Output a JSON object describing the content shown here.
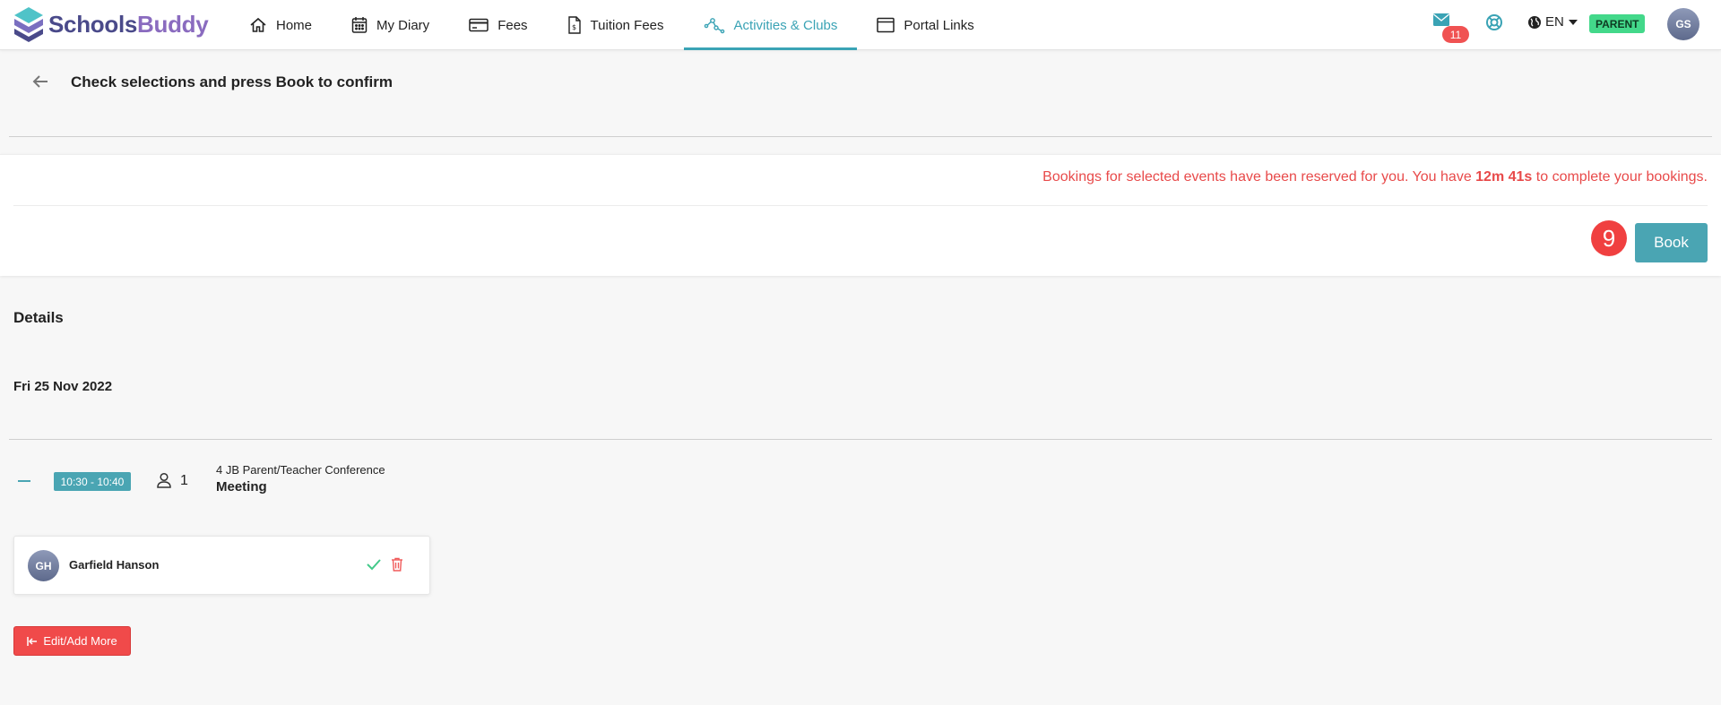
{
  "app": {
    "logo_schools": "Schools",
    "logo_buddy": "Buddy"
  },
  "nav": {
    "items": [
      {
        "label": "Home",
        "icon": "home-icon"
      },
      {
        "label": "My Diary",
        "icon": "calendar-icon"
      },
      {
        "label": "Fees",
        "icon": "credit-card-icon"
      },
      {
        "label": "Tuition Fees",
        "icon": "invoice-icon"
      },
      {
        "label": "Activities & Clubs",
        "icon": "activities-icon",
        "active": true
      },
      {
        "label": "Portal Links",
        "icon": "browser-window-icon"
      }
    ],
    "mail_count": "11",
    "language": "EN",
    "role": "PARENT",
    "user_initials": "GS"
  },
  "header": {
    "title": "Check selections and press Book to confirm"
  },
  "reservation": {
    "message_prefix": "Bookings for selected events have been reserved for you. You have ",
    "time_remaining": "12m 41s",
    "message_suffix": " to complete your bookings.",
    "step_number": "9",
    "book_label": "Book"
  },
  "details": {
    "title": "Details",
    "date": "Fri 25 Nov 2022",
    "event": {
      "time": "10:30 - 10:40",
      "attendee_count": "1",
      "subtitle": "4 JB Parent/Teacher Conference",
      "name": "Meeting"
    },
    "attendee": {
      "initials": "GH",
      "name": "Garfield Hanson"
    },
    "edit_label": "Edit/Add More"
  },
  "colors": {
    "accent": "#4aa5b3",
    "danger": "#f04a4a",
    "role_badge": "#43d88a"
  }
}
